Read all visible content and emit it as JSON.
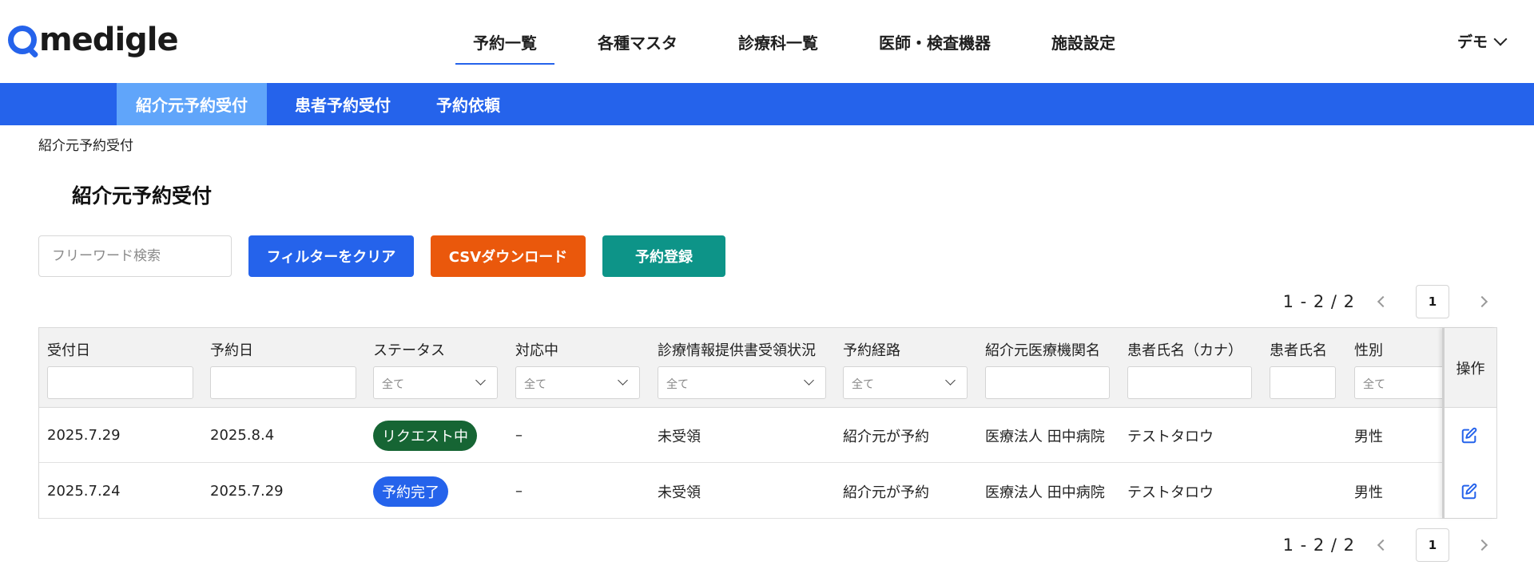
{
  "brand": {
    "logo_text": "medigle",
    "accent": "#2563eb"
  },
  "main_nav": [
    {
      "label": "予約一覧",
      "active": true
    },
    {
      "label": "各種マスタ",
      "active": false
    },
    {
      "label": "診療科一覧",
      "active": false
    },
    {
      "label": "医師・検査機器",
      "active": false
    },
    {
      "label": "施設設定",
      "active": false
    }
  ],
  "user_menu": {
    "label": "デモ",
    "icon": "chevron-down-icon"
  },
  "sub_nav": [
    {
      "label": "紹介元予約受付",
      "active": true
    },
    {
      "label": "患者予約受付",
      "active": false
    },
    {
      "label": "予約依頼",
      "active": false
    }
  ],
  "breadcrumb": "紹介元予約受付",
  "page_title": "紹介元予約受付",
  "toolbar": {
    "search_placeholder": "フリーワード検索",
    "clear_filter": {
      "label": "フィルターをクリア",
      "color": "#2563eb"
    },
    "csv_download": {
      "label": "CSVダウンロード",
      "color": "#ea580c"
    },
    "register": {
      "label": "予約登録",
      "color": "#0d9488"
    }
  },
  "pagination": {
    "range": "1 - 2 / 2",
    "current_page": "1"
  },
  "table": {
    "columns": [
      {
        "label": "受付日",
        "filter": "text"
      },
      {
        "label": "予約日",
        "filter": "text"
      },
      {
        "label": "ステータス",
        "filter": "select",
        "selected": "全て"
      },
      {
        "label": "対応中",
        "filter": "select",
        "selected": "全て"
      },
      {
        "label": "診療情報提供書受領状況",
        "filter": "select",
        "selected": "全て"
      },
      {
        "label": "予約経路",
        "filter": "select",
        "selected": "全て"
      },
      {
        "label": "紹介元医療機関名",
        "filter": "text"
      },
      {
        "label": "患者氏名（カナ）",
        "filter": "text"
      },
      {
        "label": "患者氏名",
        "filter": "text"
      },
      {
        "label": "性別",
        "filter": "select",
        "selected": "全て"
      }
    ],
    "ops_label": "操作",
    "rows": [
      {
        "received": "2025.7.29",
        "reserved": "2025.8.4",
        "status": {
          "label": "リクエスト中",
          "color": "#166534"
        },
        "handling": "–",
        "doc_status": "未受領",
        "route": "紹介元が予約",
        "hospital": "医療法人 田中病院",
        "kana": "テストタロウ",
        "name": "",
        "gender": "男性"
      },
      {
        "received": "2025.7.24",
        "reserved": "2025.7.29",
        "status": {
          "label": "予約完了",
          "color": "#2563eb"
        },
        "handling": "–",
        "doc_status": "未受領",
        "route": "紹介元が予約",
        "hospital": "医療法人 田中病院",
        "kana": "テストタロウ",
        "name": "",
        "gender": "男性"
      }
    ]
  }
}
